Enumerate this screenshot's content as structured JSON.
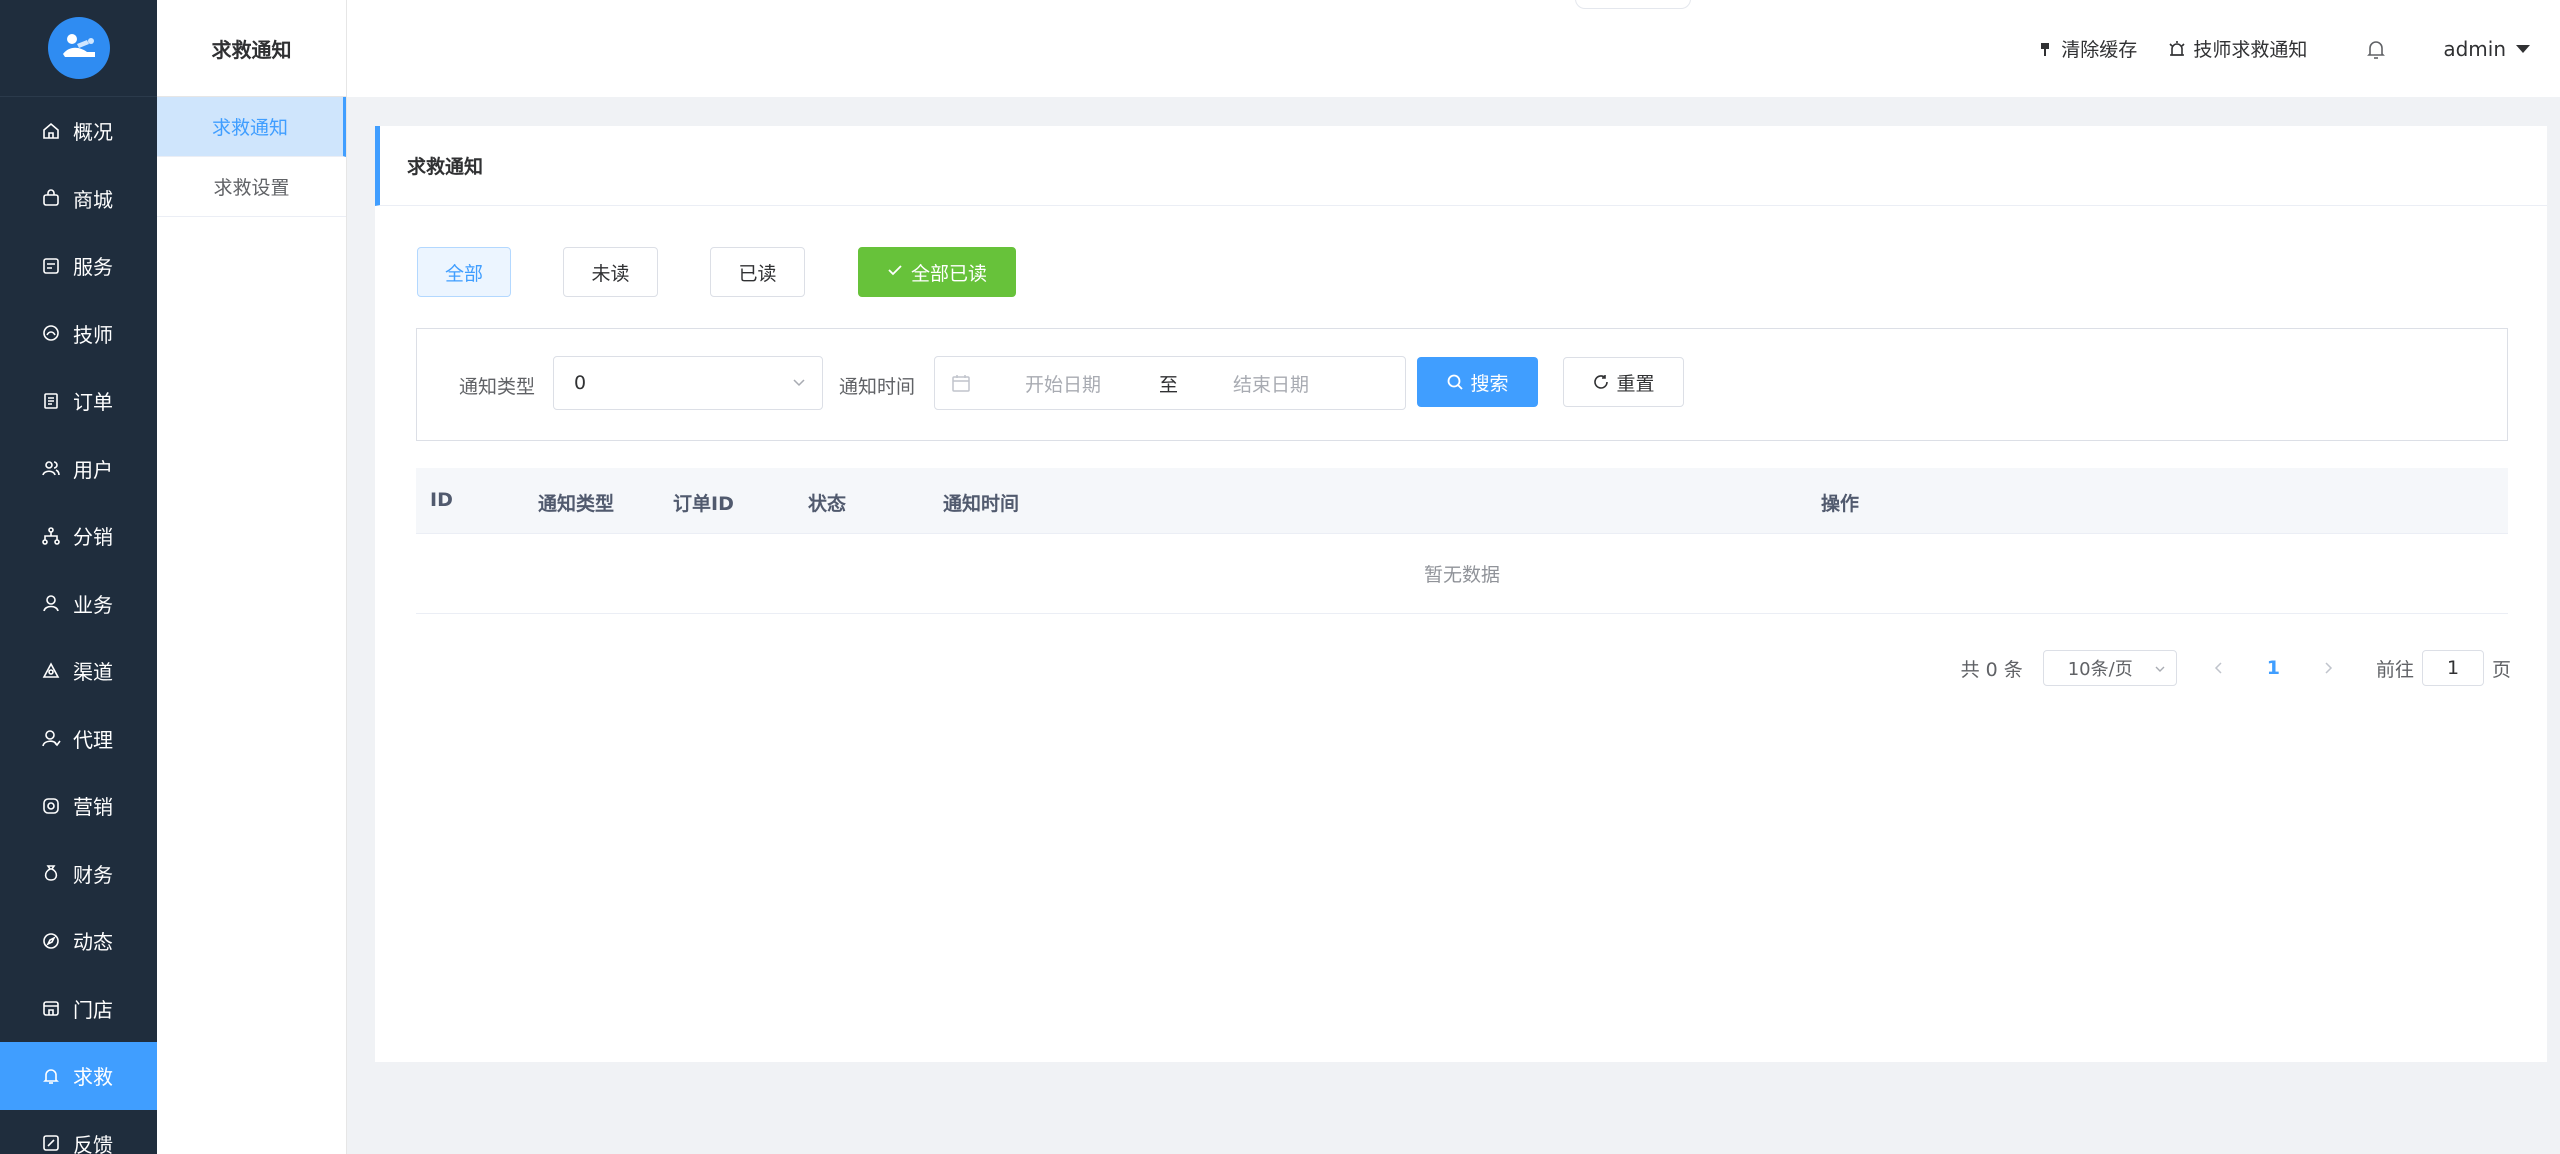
{
  "sidebar": {
    "items": [
      {
        "label": "概况",
        "icon": "home-icon"
      },
      {
        "label": "商城",
        "icon": "shop-bag-icon"
      },
      {
        "label": "服务",
        "icon": "service-icon"
      },
      {
        "label": "技师",
        "icon": "technician-icon"
      },
      {
        "label": "订单",
        "icon": "order-icon"
      },
      {
        "label": "用户",
        "icon": "users-icon"
      },
      {
        "label": "分销",
        "icon": "distribution-icon"
      },
      {
        "label": "业务",
        "icon": "user-icon"
      },
      {
        "label": "渠道",
        "icon": "channel-icon"
      },
      {
        "label": "代理",
        "icon": "agent-icon"
      },
      {
        "label": "营销",
        "icon": "marketing-icon"
      },
      {
        "label": "财务",
        "icon": "money-bag-icon"
      },
      {
        "label": "动态",
        "icon": "compass-icon"
      },
      {
        "label": "门店",
        "icon": "store-icon"
      },
      {
        "label": "求救",
        "icon": "bell-icon"
      },
      {
        "label": "反馈",
        "icon": "feedback-icon"
      }
    ],
    "active_index": 14
  },
  "submenu": {
    "title": "求救通知",
    "items": [
      "求救通知",
      "求救设置"
    ]
  },
  "header": {
    "clear_cache": "清除缓存",
    "tech_notice": "技师求救通知",
    "user": "admin"
  },
  "card": {
    "title": "求救通知",
    "filters": {
      "all": "全部",
      "unread": "未读",
      "read": "已读",
      "mark_all_read": "全部已读"
    },
    "search": {
      "type_label": "通知类型",
      "type_value": "0",
      "time_label": "通知时间",
      "start_placeholder": "开始日期",
      "separator": "至",
      "end_placeholder": "结束日期",
      "search_btn": "搜索",
      "reset_btn": "重置"
    },
    "table": {
      "columns": [
        "ID",
        "通知类型",
        "订单ID",
        "状态",
        "通知时间",
        "操作"
      ],
      "empty_text": "暂无数据"
    },
    "pagination": {
      "total": "共 0 条",
      "page_size": "10条/页",
      "current_page": "1",
      "goto_prefix": "前往",
      "goto_value": "1",
      "goto_suffix": "页"
    }
  },
  "colors": {
    "sidebar_bg": "#1f2d3d",
    "primary": "#409eff",
    "success": "#67c23a"
  }
}
